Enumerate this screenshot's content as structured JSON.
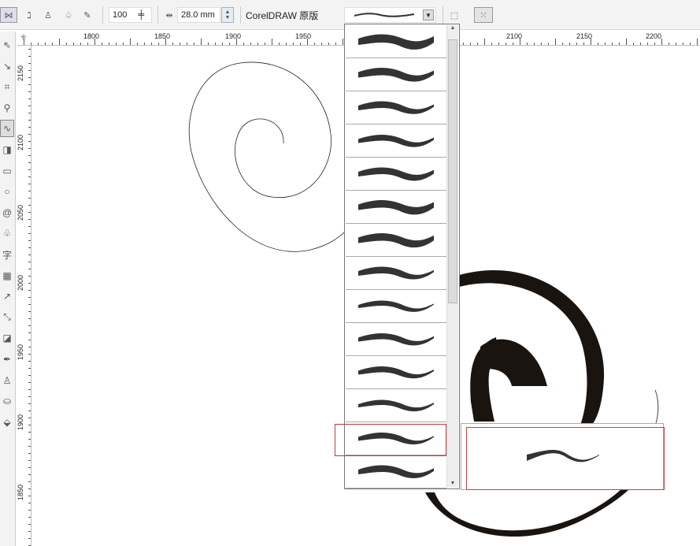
{
  "toolbar": {
    "tools": [
      "preset-brush-icon",
      "brush-icon",
      "sprayer-icon",
      "calligraphic-icon",
      "pressure-icon"
    ],
    "smoothing_value": "100",
    "stroke_width_value": "28.0 mm",
    "category_label": "CorelDRAW 原版"
  },
  "ruler": {
    "horizontal_labels": [
      "1800",
      "1850",
      "1900",
      "1950",
      "2100",
      "2150",
      "2200"
    ],
    "vertical_labels": [
      "2150",
      "2100",
      "2050",
      "2000",
      "1950",
      "1900",
      "1850"
    ]
  },
  "left_tools": [
    "pick-icon",
    "shape-icon",
    "crop-icon",
    "zoom-icon",
    "freehand-icon",
    "smart-fill-icon",
    "rectangle-icon",
    "ellipse-icon",
    "spiral-icon",
    "basic-shapes-icon",
    "text-icon",
    "table-icon",
    "dimension-icon",
    "connector-icon",
    "blend-icon",
    "eyedropper-icon",
    "outline-icon",
    "fill-icon",
    "interactive-fill-icon"
  ],
  "brush_list": {
    "count": 14,
    "selected_index": 12,
    "highlight_color": "#c0393b"
  },
  "colors": {
    "stroke": "#1a1410"
  }
}
